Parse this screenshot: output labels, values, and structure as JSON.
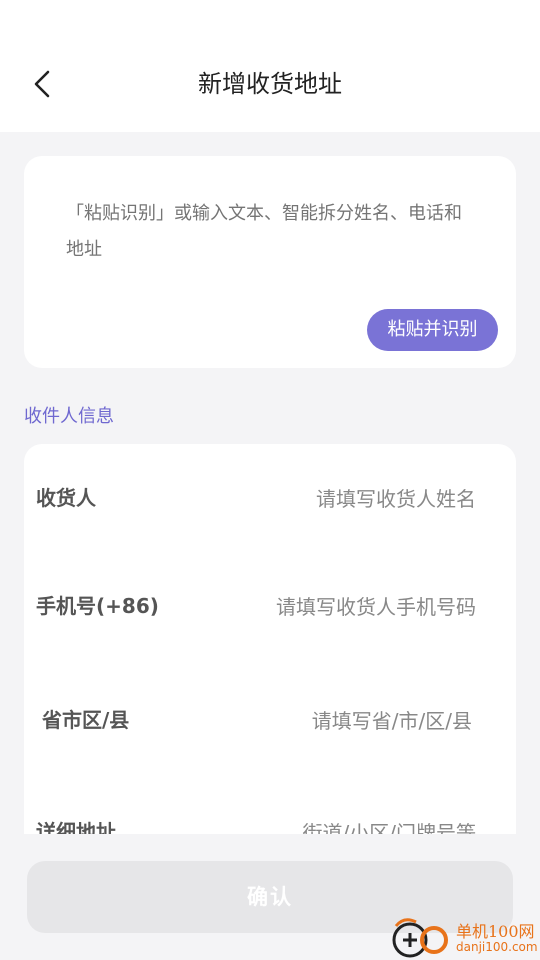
{
  "header": {
    "back_icon": "chevron-left-icon",
    "title": "新增收货地址"
  },
  "paste": {
    "placeholder": "「粘贴识别」或输入文本、智能拆分姓名、电话和地址",
    "button_label": "粘贴并识别",
    "button_color": "#7a73d6"
  },
  "recipient_section": {
    "label": "收件人信息",
    "label_color": "#6f68d0"
  },
  "form": {
    "fields": [
      {
        "label": "收货人",
        "placeholder": "请填写收货人姓名"
      },
      {
        "label": "手机号(+86)",
        "placeholder": "请填写收货人手机号码"
      },
      {
        "label": "省市区/县",
        "placeholder": "请填写省/市/区/县"
      },
      {
        "label": "详细地址",
        "placeholder": "街道/小区/门牌号等"
      }
    ]
  },
  "confirm": {
    "label": "确认",
    "state": "disabled"
  },
  "watermark": {
    "name": "单机100网",
    "url": "danji100.com"
  }
}
